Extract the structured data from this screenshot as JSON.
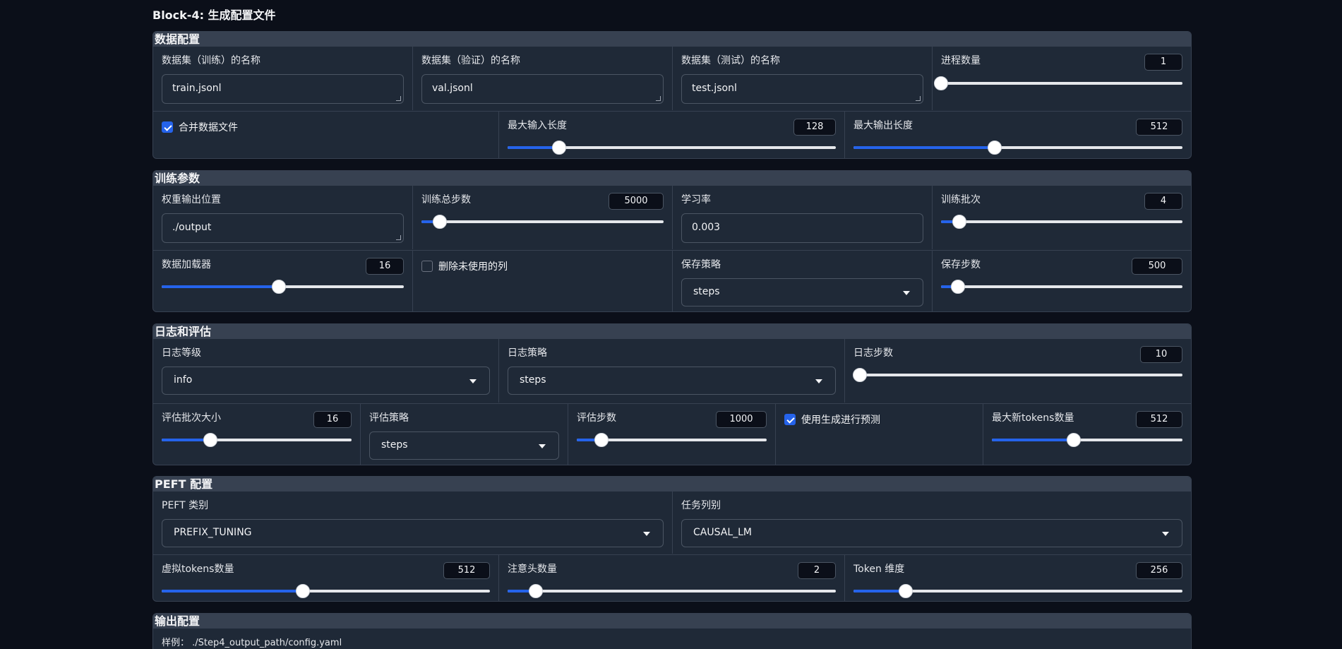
{
  "page_title": "Block-4: 生成配置文件",
  "data_section": {
    "title": "数据配置",
    "train_name": {
      "label": "数据集（训练）的名称",
      "value": "train.jsonl"
    },
    "val_name": {
      "label": "数据集（验证）的名称",
      "value": "val.jsonl"
    },
    "test_name": {
      "label": "数据集（测试）的名称",
      "value": "test.jsonl"
    },
    "num_proc": {
      "label": "进程数量",
      "value": "1",
      "fraction": 0.0
    },
    "merge_files": {
      "label": "合并数据文件",
      "checked": true
    },
    "max_input_len": {
      "label": "最大输入长度",
      "value": "128",
      "fraction": 0.156
    },
    "max_output_len": {
      "label": "最大输出长度",
      "value": "512",
      "fraction": 0.43
    }
  },
  "train_section": {
    "title": "训练参数",
    "output_dir": {
      "label": "权重输出位置",
      "value": "./output"
    },
    "max_steps": {
      "label": "训练总步数",
      "value": "5000",
      "fraction": 0.075
    },
    "learning_rate": {
      "label": "学习率",
      "value": "0.003"
    },
    "batch_size": {
      "label": "训练批次",
      "value": "4",
      "fraction": 0.075
    },
    "dataloader": {
      "label": "数据加载器",
      "value": "16",
      "fraction": 0.485
    },
    "remove_unused": {
      "label": "删除未使用的列",
      "checked": false
    },
    "save_strategy": {
      "label": "保存策略",
      "value": "steps"
    },
    "save_steps": {
      "label": "保存步数",
      "value": "500",
      "fraction": 0.07
    }
  },
  "log_section": {
    "title": "日志和评估",
    "log_level": {
      "label": "日志等级",
      "value": "info"
    },
    "log_strategy": {
      "label": "日志策略",
      "value": "steps"
    },
    "log_steps": {
      "label": "日志步数",
      "value": "10",
      "fraction": 0.02
    },
    "eval_batch": {
      "label": "评估批次大小",
      "value": "16",
      "fraction": 0.255
    },
    "eval_strategy": {
      "label": "评估策略",
      "value": "steps"
    },
    "eval_steps": {
      "label": "评估步数",
      "value": "1000",
      "fraction": 0.13
    },
    "predict_with_generate": {
      "label": "使用生成进行预测",
      "checked": true
    },
    "max_new_tokens": {
      "label": "最大新tokens数量",
      "value": "512",
      "fraction": 0.43
    }
  },
  "peft_section": {
    "title": "PEFT 配置",
    "peft_type": {
      "label": "PEFT 类别",
      "value": "PREFIX_TUNING"
    },
    "task_type": {
      "label": "任务列别",
      "value": "CAUSAL_LM"
    },
    "virtual_tokens": {
      "label": "虚拟tokens数量",
      "value": "512",
      "fraction": 0.43
    },
    "attention_heads": {
      "label": "注意头数量",
      "value": "2",
      "fraction": 0.085
    },
    "token_dim": {
      "label": "Token 维度",
      "value": "256",
      "fraction": 0.158
    }
  },
  "output_section": {
    "title": "输出配置",
    "example": "样例：  ./Step4_output_path/config.yaml"
  },
  "colors": {
    "accent": "#2563eb",
    "background": "#0b0f19",
    "panel": "#1f2937"
  }
}
